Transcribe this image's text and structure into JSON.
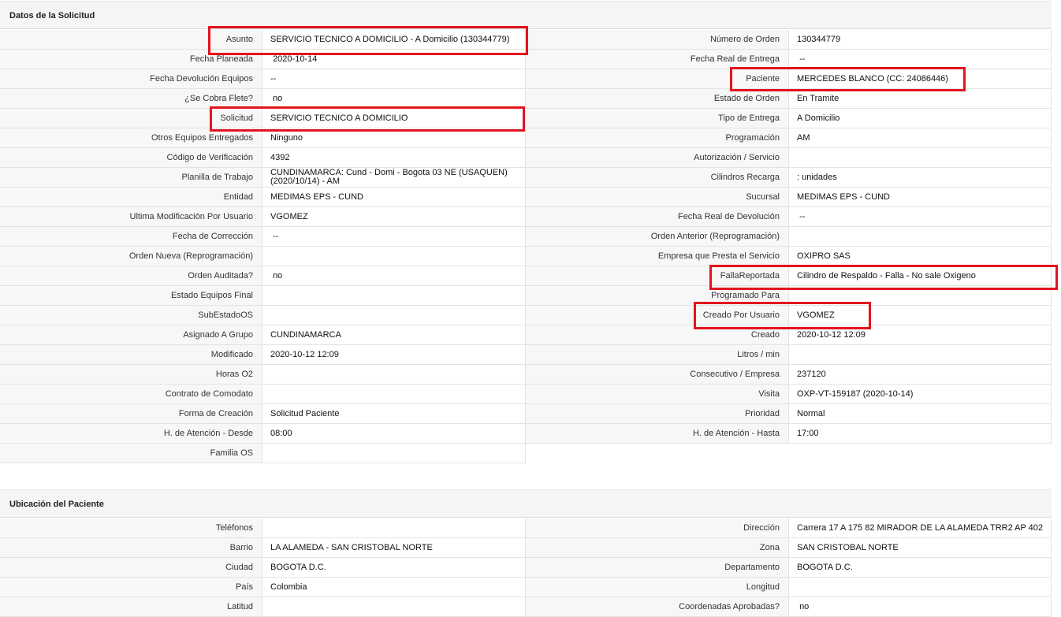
{
  "solicitud": {
    "title": "Datos de la Solicitud",
    "left": [
      {
        "label": "Asunto",
        "value": "SERVICIO TECNICO A DOMICILIO - A Domicilio (130344779)"
      },
      {
        "label": "Fecha Planeada",
        "value": " 2020-10-14"
      },
      {
        "label": "Fecha Devolución Equipos",
        "value": "--"
      },
      {
        "label": "¿Se Cobra Flete?",
        "value": " no"
      },
      {
        "label": "Solicitud",
        "value": "SERVICIO TECNICO A DOMICILIO"
      },
      {
        "label": "Otros Equipos Entregados",
        "value": "Ninguno"
      },
      {
        "label": "Código de Verificación",
        "value": "4392"
      },
      {
        "label": "Planilla de Trabajo",
        "value": "CUNDINAMARCA: Cund - Domi - Bogota 03 NE (USAQUEN) (2020/10/14) - AM"
      },
      {
        "label": "Entidad",
        "value": "MEDIMAS EPS - CUND"
      },
      {
        "label": "Ultima Modificación Por Usuario",
        "value": "VGOMEZ"
      },
      {
        "label": "Fecha de Corrección",
        "value": " --"
      },
      {
        "label": "Orden Nueva (Reprogramación)",
        "value": ""
      },
      {
        "label": "Orden Auditada?",
        "value": " no"
      },
      {
        "label": "Estado Equipos Final",
        "value": ""
      },
      {
        "label": "SubEstadoOS",
        "value": ""
      },
      {
        "label": "Asignado A Grupo",
        "value": "CUNDINAMARCA"
      },
      {
        "label": "Modificado",
        "value": "2020-10-12 12:09"
      },
      {
        "label": "Horas O2",
        "value": ""
      },
      {
        "label": "Contrato de Comodato",
        "value": ""
      },
      {
        "label": "Forma de Creación",
        "value": "Solicitud Paciente"
      },
      {
        "label": "H. de Atención - Desde",
        "value": "08:00"
      },
      {
        "label": "Familia OS",
        "value": ""
      }
    ],
    "right": [
      {
        "label": "Número de Orden",
        "value": "130344779"
      },
      {
        "label": "Fecha Real de Entrega",
        "value": " --"
      },
      {
        "label": "Paciente",
        "value": "MERCEDES BLANCO (CC: 24086446)"
      },
      {
        "label": "Estado de Orden",
        "value": "En Tramite"
      },
      {
        "label": "Tipo de Entrega",
        "value": "A Domicilio"
      },
      {
        "label": "Programación",
        "value": "AM"
      },
      {
        "label": "Autorización / Servicio",
        "value": ""
      },
      {
        "label": "Cilindros Recarga",
        "value": ": unidades"
      },
      {
        "label": "Sucursal",
        "value": "MEDIMAS EPS - CUND"
      },
      {
        "label": "Fecha Real de Devolución",
        "value": " --"
      },
      {
        "label": "Orden Anterior (Reprogramación)",
        "value": ""
      },
      {
        "label": "Empresa que Presta el Servicio",
        "value": "OXIPRO SAS"
      },
      {
        "label": "FallaReportada",
        "value": "Cilindro de Respaldo - Falla - No sale Oxigeno"
      },
      {
        "label": "Programado Para",
        "value": ""
      },
      {
        "label": "Creado Por Usuario",
        "value": "VGOMEZ"
      },
      {
        "label": "Creado",
        "value": "2020-10-12 12:09"
      },
      {
        "label": "Litros / min",
        "value": ""
      },
      {
        "label": "Consecutivo / Empresa",
        "value": "237120"
      },
      {
        "label": "Visita",
        "value": "OXP-VT-159187 (2020-10-14)"
      },
      {
        "label": "Prioridad",
        "value": "Normal"
      },
      {
        "label": "H. de Atención - Hasta",
        "value": "17:00"
      }
    ]
  },
  "ubicacion": {
    "title": "Ubicación del Paciente",
    "left": [
      {
        "label": "Teléfonos",
        "value": ""
      },
      {
        "label": "Barrio",
        "value": "LA ALAMEDA - SAN CRISTOBAL NORTE"
      },
      {
        "label": "Ciudad",
        "value": "BOGOTA D.C."
      },
      {
        "label": "País",
        "value": "Colombia"
      },
      {
        "label": "Latitud",
        "value": ""
      }
    ],
    "right": [
      {
        "label": "Dirección",
        "value": "Carrera 17 A 175 82 MIRADOR DE LA ALAMEDA TRR2 AP 402"
      },
      {
        "label": "Zona",
        "value": "SAN CRISTOBAL NORTE"
      },
      {
        "label": "Departamento",
        "value": "BOGOTA D.C."
      },
      {
        "label": "Longitud",
        "value": ""
      },
      {
        "label": "Coordenadas Aprobadas?",
        "value": " no"
      }
    ]
  }
}
